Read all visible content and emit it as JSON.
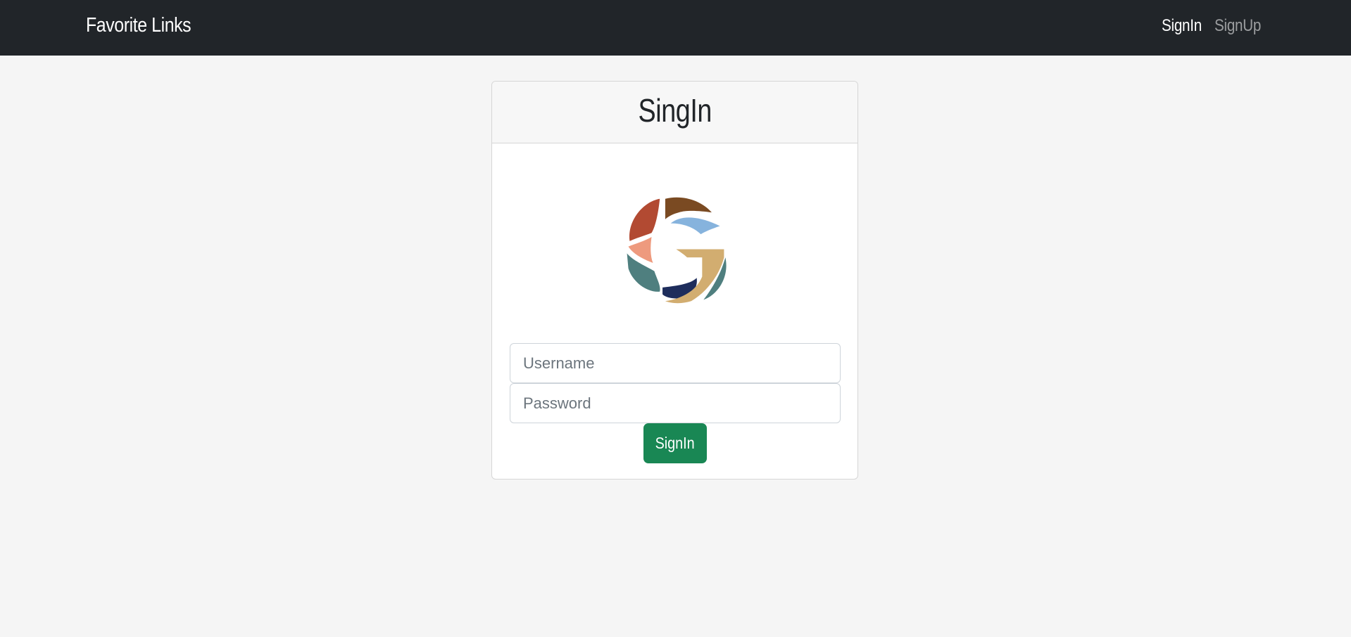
{
  "navbar": {
    "brand": "Favorite Links",
    "links": [
      {
        "label": "SignIn",
        "active": true
      },
      {
        "label": "SignUp",
        "active": false
      }
    ]
  },
  "card": {
    "title": "SingIn",
    "logo": "G-logo-icon",
    "username_placeholder": "Username",
    "password_placeholder": "Password",
    "submit_label": "SignIn"
  },
  "colors": {
    "navbar_bg": "#212529",
    "page_bg": "#f5f5f5",
    "button_bg": "#198754"
  }
}
